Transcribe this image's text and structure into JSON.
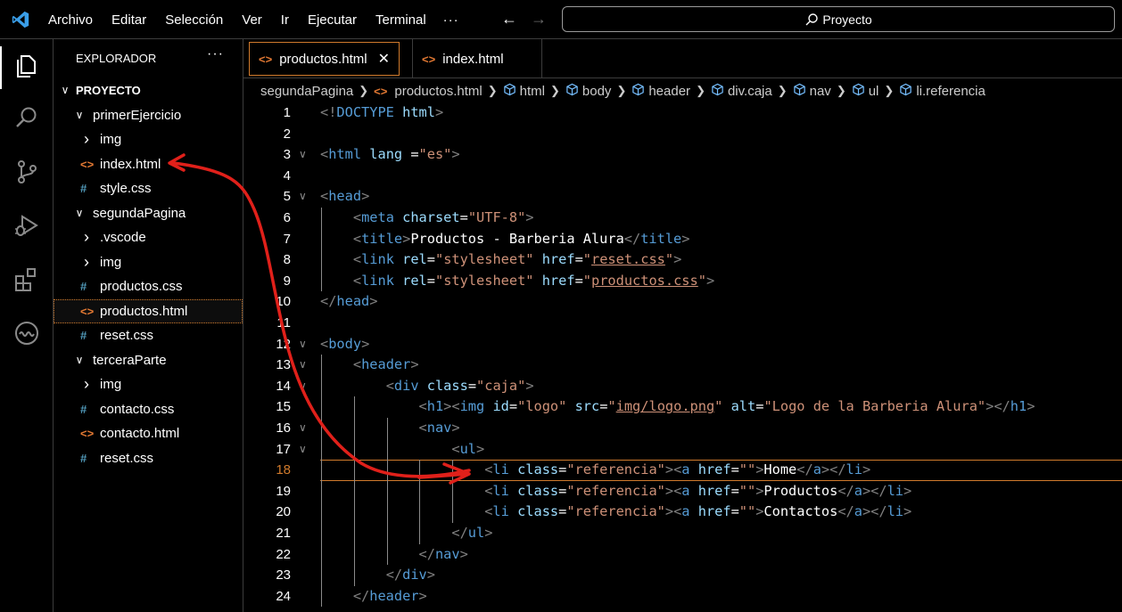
{
  "menu": {
    "items": [
      "Archivo",
      "Editar",
      "Selección",
      "Ver",
      "Ir",
      "Ejecutar",
      "Terminal"
    ],
    "more": "···"
  },
  "command_center": {
    "text": "Proyecto"
  },
  "activity_bar": {
    "icons": [
      "explorer-icon",
      "search-icon",
      "source-control-icon",
      "run-debug-icon",
      "extensions-icon",
      "remote-icon"
    ]
  },
  "sidebar": {
    "header": "EXPLORADOR",
    "more": "···",
    "tree": [
      {
        "label": "PROYECTO",
        "type": "root",
        "depth": 0,
        "expanded": true
      },
      {
        "label": "primerEjercicio",
        "type": "folder",
        "depth": 1,
        "expanded": true
      },
      {
        "label": "img",
        "type": "folder",
        "depth": 2,
        "expanded": false
      },
      {
        "label": "index.html",
        "type": "html",
        "depth": 2
      },
      {
        "label": "style.css",
        "type": "css",
        "depth": 2
      },
      {
        "label": "segundaPagina",
        "type": "folder",
        "depth": 1,
        "expanded": true
      },
      {
        "label": ".vscode",
        "type": "folder",
        "depth": 2,
        "expanded": false
      },
      {
        "label": "img",
        "type": "folder",
        "depth": 2,
        "expanded": false
      },
      {
        "label": "productos.css",
        "type": "css",
        "depth": 2
      },
      {
        "label": "productos.html",
        "type": "html",
        "depth": 2,
        "selected": true
      },
      {
        "label": "reset.css",
        "type": "css",
        "depth": 2
      },
      {
        "label": "terceraParte",
        "type": "folder",
        "depth": 1,
        "expanded": true
      },
      {
        "label": "img",
        "type": "folder",
        "depth": 2,
        "expanded": false
      },
      {
        "label": "contacto.css",
        "type": "css",
        "depth": 2
      },
      {
        "label": "contacto.html",
        "type": "html",
        "depth": 2
      },
      {
        "label": "reset.css",
        "type": "css",
        "depth": 2
      }
    ]
  },
  "tabs": [
    {
      "label": "productos.html",
      "active": true,
      "close": "✕"
    },
    {
      "label": "index.html",
      "active": false
    }
  ],
  "breadcrumb": [
    "segundaPagina",
    "productos.html",
    "html",
    "body",
    "header",
    "div.caja",
    "nav",
    "ul",
    "li.referencia"
  ],
  "editor": {
    "current_line": 18,
    "lines": [
      {
        "n": "1",
        "fold": "",
        "tokens": [
          [
            "p",
            "<!"
          ],
          [
            "t",
            "DOCTYPE"
          ],
          [
            "w",
            " "
          ],
          [
            "a",
            "html"
          ],
          [
            "p",
            ">"
          ]
        ]
      },
      {
        "n": "2",
        "fold": "",
        "tokens": []
      },
      {
        "n": "3",
        "fold": "v",
        "tokens": [
          [
            "p",
            "<"
          ],
          [
            "t",
            "html"
          ],
          [
            "w",
            " "
          ],
          [
            "a",
            "lang"
          ],
          [
            "w",
            " ="
          ],
          [
            "s",
            "\"es\""
          ],
          [
            "p",
            ">"
          ]
        ]
      },
      {
        "n": "4",
        "fold": "",
        "tokens": []
      },
      {
        "n": "5",
        "fold": "v",
        "tokens": [
          [
            "p",
            "<"
          ],
          [
            "t",
            "head"
          ],
          [
            "p",
            ">"
          ]
        ]
      },
      {
        "n": "6",
        "fold": "",
        "tokens": [
          [
            "w",
            "    "
          ],
          [
            "p",
            "<"
          ],
          [
            "t",
            "meta"
          ],
          [
            "w",
            " "
          ],
          [
            "a",
            "charset"
          ],
          [
            "w",
            "="
          ],
          [
            "s",
            "\"UTF-8\""
          ],
          [
            "p",
            ">"
          ]
        ]
      },
      {
        "n": "7",
        "fold": "",
        "tokens": [
          [
            "w",
            "    "
          ],
          [
            "p",
            "<"
          ],
          [
            "t",
            "title"
          ],
          [
            "p",
            ">"
          ],
          [
            "w",
            "Productos - Barberia Alura"
          ],
          [
            "p",
            "</"
          ],
          [
            "t",
            "title"
          ],
          [
            "p",
            ">"
          ]
        ]
      },
      {
        "n": "8",
        "fold": "",
        "tokens": [
          [
            "w",
            "    "
          ],
          [
            "p",
            "<"
          ],
          [
            "t",
            "link"
          ],
          [
            "w",
            " "
          ],
          [
            "a",
            "rel"
          ],
          [
            "w",
            "="
          ],
          [
            "s",
            "\"stylesheet\""
          ],
          [
            "w",
            " "
          ],
          [
            "a",
            "href"
          ],
          [
            "w",
            "="
          ],
          [
            "s",
            "\""
          ],
          [
            "su",
            "reset.css"
          ],
          [
            "s",
            "\""
          ],
          [
            "p",
            ">"
          ]
        ]
      },
      {
        "n": "9",
        "fold": "",
        "tokens": [
          [
            "w",
            "    "
          ],
          [
            "p",
            "<"
          ],
          [
            "t",
            "link"
          ],
          [
            "w",
            " "
          ],
          [
            "a",
            "rel"
          ],
          [
            "w",
            "="
          ],
          [
            "s",
            "\"stylesheet\""
          ],
          [
            "w",
            " "
          ],
          [
            "a",
            "href"
          ],
          [
            "w",
            "="
          ],
          [
            "s",
            "\""
          ],
          [
            "su",
            "productos.css"
          ],
          [
            "s",
            "\""
          ],
          [
            "p",
            ">"
          ]
        ]
      },
      {
        "n": "10",
        "fold": "",
        "tokens": [
          [
            "p",
            "</"
          ],
          [
            "t",
            "head"
          ],
          [
            "p",
            ">"
          ]
        ]
      },
      {
        "n": "11",
        "fold": "",
        "tokens": []
      },
      {
        "n": "12",
        "fold": "v",
        "tokens": [
          [
            "p",
            "<"
          ],
          [
            "t",
            "body"
          ],
          [
            "p",
            ">"
          ]
        ]
      },
      {
        "n": "13",
        "fold": "v",
        "tokens": [
          [
            "w",
            "    "
          ],
          [
            "p",
            "<"
          ],
          [
            "t",
            "header"
          ],
          [
            "p",
            ">"
          ]
        ]
      },
      {
        "n": "14",
        "fold": "v",
        "tokens": [
          [
            "w",
            "        "
          ],
          [
            "p",
            "<"
          ],
          [
            "t",
            "div"
          ],
          [
            "w",
            " "
          ],
          [
            "a",
            "class"
          ],
          [
            "w",
            "="
          ],
          [
            "s",
            "\"caja\""
          ],
          [
            "p",
            ">"
          ]
        ]
      },
      {
        "n": "15",
        "fold": "",
        "tokens": [
          [
            "w",
            "            "
          ],
          [
            "p",
            "<"
          ],
          [
            "t",
            "h1"
          ],
          [
            "p",
            "><"
          ],
          [
            "t",
            "img"
          ],
          [
            "w",
            " "
          ],
          [
            "a",
            "id"
          ],
          [
            "w",
            "="
          ],
          [
            "s",
            "\"logo\""
          ],
          [
            "w",
            " "
          ],
          [
            "a",
            "src"
          ],
          [
            "w",
            "="
          ],
          [
            "s",
            "\""
          ],
          [
            "su",
            "img/logo.png"
          ],
          [
            "s",
            "\""
          ],
          [
            "w",
            " "
          ],
          [
            "a",
            "alt"
          ],
          [
            "w",
            "="
          ],
          [
            "s",
            "\"Logo de la Barberia Alura\""
          ],
          [
            "p",
            "></"
          ],
          [
            "t",
            "h1"
          ],
          [
            "p",
            ">"
          ]
        ]
      },
      {
        "n": "16",
        "fold": "v",
        "tokens": [
          [
            "w",
            "            "
          ],
          [
            "p",
            "<"
          ],
          [
            "t",
            "nav"
          ],
          [
            "p",
            ">"
          ]
        ]
      },
      {
        "n": "17",
        "fold": "v",
        "tokens": [
          [
            "w",
            "                "
          ],
          [
            "p",
            "<"
          ],
          [
            "t",
            "ul"
          ],
          [
            "p",
            ">"
          ]
        ]
      },
      {
        "n": "18",
        "fold": "",
        "tokens": [
          [
            "w",
            "                    "
          ],
          [
            "p",
            "<"
          ],
          [
            "t",
            "li"
          ],
          [
            "w",
            " "
          ],
          [
            "a",
            "class"
          ],
          [
            "w",
            "="
          ],
          [
            "s",
            "\"referencia\""
          ],
          [
            "p",
            "><"
          ],
          [
            "t",
            "a"
          ],
          [
            "w",
            " "
          ],
          [
            "a",
            "href"
          ],
          [
            "w",
            "="
          ],
          [
            "s",
            "\"\""
          ],
          [
            "p",
            ">"
          ],
          [
            "w",
            "Home"
          ],
          [
            "p",
            "</"
          ],
          [
            "t",
            "a"
          ],
          [
            "p",
            "></"
          ],
          [
            "t",
            "li"
          ],
          [
            "p",
            ">"
          ]
        ]
      },
      {
        "n": "19",
        "fold": "",
        "tokens": [
          [
            "w",
            "                    "
          ],
          [
            "p",
            "<"
          ],
          [
            "t",
            "li"
          ],
          [
            "w",
            " "
          ],
          [
            "a",
            "class"
          ],
          [
            "w",
            "="
          ],
          [
            "s",
            "\"referencia\""
          ],
          [
            "p",
            "><"
          ],
          [
            "t",
            "a"
          ],
          [
            "w",
            " "
          ],
          [
            "a",
            "href"
          ],
          [
            "w",
            "="
          ],
          [
            "s",
            "\"\""
          ],
          [
            "p",
            ">"
          ],
          [
            "w",
            "Productos"
          ],
          [
            "p",
            "</"
          ],
          [
            "t",
            "a"
          ],
          [
            "p",
            "></"
          ],
          [
            "t",
            "li"
          ],
          [
            "p",
            ">"
          ]
        ]
      },
      {
        "n": "20",
        "fold": "",
        "tokens": [
          [
            "w",
            "                    "
          ],
          [
            "p",
            "<"
          ],
          [
            "t",
            "li"
          ],
          [
            "w",
            " "
          ],
          [
            "a",
            "class"
          ],
          [
            "w",
            "="
          ],
          [
            "s",
            "\"referencia\""
          ],
          [
            "p",
            "><"
          ],
          [
            "t",
            "a"
          ],
          [
            "w",
            " "
          ],
          [
            "a",
            "href"
          ],
          [
            "w",
            "="
          ],
          [
            "s",
            "\"\""
          ],
          [
            "p",
            ">"
          ],
          [
            "w",
            "Contactos"
          ],
          [
            "p",
            "</"
          ],
          [
            "t",
            "a"
          ],
          [
            "p",
            "></"
          ],
          [
            "t",
            "li"
          ],
          [
            "p",
            ">"
          ]
        ]
      },
      {
        "n": "21",
        "fold": "",
        "tokens": [
          [
            "w",
            "                "
          ],
          [
            "p",
            "</"
          ],
          [
            "t",
            "ul"
          ],
          [
            "p",
            ">"
          ]
        ]
      },
      {
        "n": "22",
        "fold": "",
        "tokens": [
          [
            "w",
            "            "
          ],
          [
            "p",
            "</"
          ],
          [
            "t",
            "nav"
          ],
          [
            "p",
            ">"
          ]
        ]
      },
      {
        "n": "23",
        "fold": "",
        "tokens": [
          [
            "w",
            "        "
          ],
          [
            "p",
            "</"
          ],
          [
            "t",
            "div"
          ],
          [
            "p",
            ">"
          ]
        ]
      },
      {
        "n": "24",
        "fold": "",
        "tokens": [
          [
            "w",
            "    "
          ],
          [
            "p",
            "</"
          ],
          [
            "t",
            "header"
          ],
          [
            "p",
            ">"
          ]
        ]
      }
    ]
  },
  "colors": {
    "accent": "#d07a2c",
    "tag": "#569cd6",
    "attr": "#9cdcfe",
    "string": "#ce9178",
    "annotation": "#e0201a"
  }
}
